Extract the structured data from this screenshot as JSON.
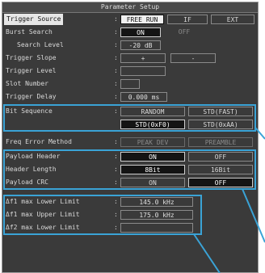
{
  "title": "Parameter Setup",
  "trigger_source": {
    "label": "Trigger Source",
    "options": [
      "FREE RUN",
      "IF",
      "EXT"
    ]
  },
  "burst_search": {
    "label": "Burst Search",
    "options": [
      "ON",
      "OFF"
    ]
  },
  "search_level": {
    "label": "Search Level",
    "value": "-20 dB"
  },
  "trigger_slope": {
    "label": "Trigger Slope",
    "options": [
      "+",
      "-"
    ]
  },
  "trigger_level": {
    "label": "Trigger Level",
    "value": ""
  },
  "slot_number": {
    "label": "Slot Number",
    "value": ""
  },
  "trigger_delay": {
    "label": "Trigger Delay",
    "value": "0.000 ms"
  },
  "bit_sequence": {
    "label": "Bit Sequence",
    "options": [
      "RANDOM",
      "STD(FAST)",
      "STD(0xF0)",
      "STD(0xAA)"
    ]
  },
  "freq_error_method": {
    "label": "Freq Error Method",
    "options": [
      "PEAK DEV",
      "PREAMBLE"
    ]
  },
  "payload_header": {
    "label": "Payload Header",
    "options": [
      "ON",
      "OFF"
    ]
  },
  "header_length": {
    "label": "Header Length",
    "options": [
      "8Bit",
      "16Bit"
    ]
  },
  "payload_crc": {
    "label": "Payload CRC",
    "options": [
      "ON",
      "OFF"
    ]
  },
  "df1_lower": {
    "label": "Δf1 max Lower Limit",
    "value": "145.0 kHz"
  },
  "df1_upper": {
    "label": "Δf1 max Upper Limit",
    "value": "175.0 kHz"
  },
  "df2_lower": {
    "label": "Δf2 max Lower Limit",
    "value": ""
  },
  "colon": ":",
  "colors": {
    "panel": "#3a3a3a",
    "highlight": "#3aa3d6",
    "selected": "#141414"
  }
}
